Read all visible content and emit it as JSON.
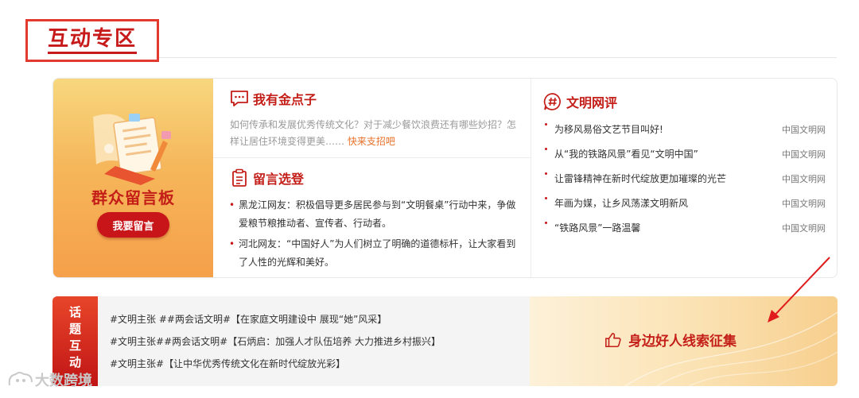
{
  "section": {
    "title": "互动专区"
  },
  "board": {
    "title": "群众留言板",
    "button": "我要留言"
  },
  "gold": {
    "title": "我有金点子",
    "text": "如何传承和发展优秀传统文化？对于减少餐饮浪费还有哪些妙招？怎样让居住环境变得更美……",
    "link": "快来支招吧"
  },
  "messages": {
    "title": "留言选登",
    "items": [
      "黑龙江网友：积极倡导更多居民参与到“文明餐桌”行动中来，争做爱粮节粮推动者、宣传者、行动者。",
      "河北网友：“中国好人”为人们树立了明确的道德标杆，让大家看到了人性的光辉和美好。"
    ]
  },
  "review": {
    "title": "文明网评",
    "items": [
      {
        "text": "为移风易俗文艺节目叫好!",
        "source": "中国文明网"
      },
      {
        "text": "从“我的铁路风景”看见“文明中国”",
        "source": "中国文明网"
      },
      {
        "text": "让雷锋精神在新时代绽放更加璀璨的光芒",
        "source": "中国文明网"
      },
      {
        "text": "年画为媒，让乡风荡漾文明新风",
        "source": "中国文明网"
      },
      {
        "text": "“铁路风景”一路温馨",
        "source": "中国文明网"
      }
    ]
  },
  "topic": {
    "tag_lines": [
      "话",
      "题",
      "互",
      "动"
    ],
    "items": [
      "#文明主张 ##两会话文明#【在家庭文明建设中 展现“她”风采】",
      "#文明主张##两会话文明#【石炳启：加强人才队伍培养 大力推进乡村振兴】",
      "#文明主张#【让中华优秀传统文化在新时代绽放光彩】"
    ],
    "banner": "身边好人线索征集"
  },
  "watermark": "大数跨境",
  "colors": {
    "accent": "#c41e18",
    "button": "#c8151a",
    "link": "#e8702a"
  }
}
